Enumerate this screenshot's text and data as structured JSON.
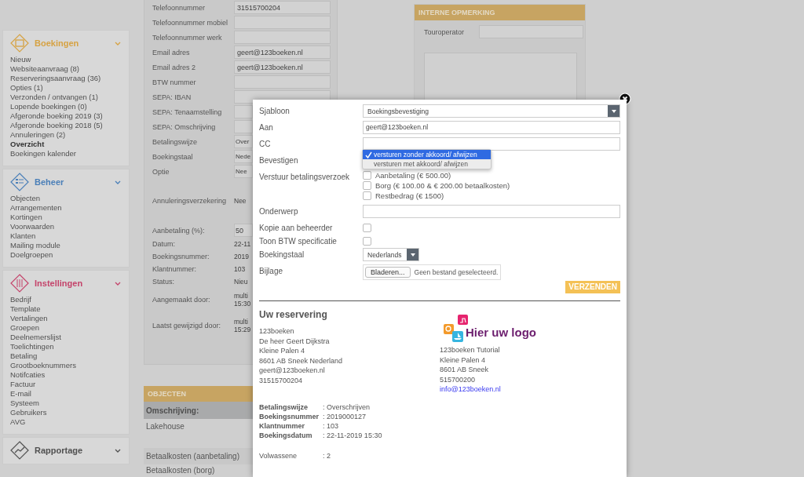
{
  "sidebar": {
    "sections": [
      {
        "title": "Boekingen",
        "color": "#d6a243",
        "items": [
          {
            "label": "Nieuw",
            "selected": false
          },
          {
            "label": "Websiteaanvraag (8)",
            "selected": false
          },
          {
            "label": "Reserveringsaanvraag (36)",
            "selected": false
          },
          {
            "label": "Opties (1)",
            "selected": false
          },
          {
            "label": "Verzonden / ontvangen (1)",
            "selected": false
          },
          {
            "label": "Lopende boekingen (0)",
            "selected": false
          },
          {
            "label": "Afgeronde boeking 2019 (3)",
            "selected": false
          },
          {
            "label": "Afgeronde boeking 2018 (5)",
            "selected": false
          },
          {
            "label": "Annuleringen (2)",
            "selected": false
          },
          {
            "label": "Overzicht",
            "selected": true
          },
          {
            "label": "Boekingen kalender",
            "selected": false
          }
        ]
      },
      {
        "title": "Beheer",
        "color": "#4a7fb8",
        "items": [
          {
            "label": "Objecten",
            "selected": false
          },
          {
            "label": "Arrangementen",
            "selected": false
          },
          {
            "label": "Kortingen",
            "selected": false
          },
          {
            "label": "Voorwaarden",
            "selected": false
          },
          {
            "label": "Klanten",
            "selected": false
          },
          {
            "label": "Mailing module",
            "selected": false
          },
          {
            "label": "Doelgroepen",
            "selected": false
          }
        ]
      },
      {
        "title": "Instellingen",
        "color": "#c4436a",
        "items": [
          {
            "label": "Bedrijf",
            "selected": false
          },
          {
            "label": "Template",
            "selected": false
          },
          {
            "label": "Vertalingen",
            "selected": false
          },
          {
            "label": "Groepen",
            "selected": false
          },
          {
            "label": "Deelnemerslijst",
            "selected": false
          },
          {
            "label": "Toelichtingen",
            "selected": false
          },
          {
            "label": "Betaling",
            "selected": false
          },
          {
            "label": "Grootboeknummers",
            "selected": false
          },
          {
            "label": "Notifcaties",
            "selected": false
          },
          {
            "label": "Factuur",
            "selected": false
          },
          {
            "label": "E-mail",
            "selected": false
          },
          {
            "label": "Systeem",
            "selected": false
          },
          {
            "label": "Gebruikers",
            "selected": false
          },
          {
            "label": "AVG",
            "selected": false
          }
        ]
      },
      {
        "title": "Rapportage",
        "color": "#505050"
      }
    ]
  },
  "customer_form": {
    "sections": [
      [
        {
          "kind": "input",
          "label": "Telefoonnummer",
          "value": "31515700204"
        },
        {
          "kind": "input",
          "label": "Telefoonnummer mobiel"
        },
        {
          "kind": "input",
          "label": "Telefoonnummer werk"
        },
        {
          "kind": "input",
          "label": "Email adres",
          "value": "geert@123boeken.nl"
        },
        {
          "kind": "input",
          "label": "Email adres 2",
          "value": "geert@123boeken.nl"
        },
        {
          "kind": "input",
          "label": "BTW nummer"
        },
        {
          "kind": "input",
          "label": "SEPA: IBAN"
        },
        {
          "kind": "input",
          "label": "SEPA: Tenaamstelling"
        },
        {
          "kind": "input",
          "label": "SEPA: Omschrijving"
        },
        {
          "kind": "input",
          "label": "Betalingswijze",
          "value": "Over"
        },
        {
          "kind": "input",
          "label": "Boekingstaal",
          "value": "Nede"
        },
        {
          "kind": "input",
          "label": "Optie",
          "value": "Nee"
        }
      ],
      [
        {
          "kind": "text",
          "label": "Annuleringsverzekering",
          "value": "Nee"
        }
      ],
      [
        {
          "kind": "input",
          "label": "Aanbetaling (%):",
          "value": "50"
        },
        {
          "kind": "text",
          "label": "Datum:",
          "value": "22-11"
        },
        {
          "kind": "text",
          "label": "Boekingsnummer:",
          "value": "2019"
        },
        {
          "kind": "text",
          "label": "Klantnummer:",
          "value": "103"
        },
        {
          "kind": "text",
          "label": "Status:",
          "value": "Nieu"
        },
        {
          "kind": "lines",
          "label": "Aangemaakt door:",
          "lines": [
            "multi",
            "15:30"
          ]
        },
        {
          "kind": "lines",
          "label": "Laatst gewijzigd door:",
          "lines": [
            "multi",
            "15:29"
          ]
        }
      ]
    ]
  },
  "objects": {
    "title": "OBJECTEN",
    "header": "Omschrijving:",
    "rows": [
      "Lakehouse",
      "Betaalkosten (aanbetaling)",
      "Betaalkosten (borg)"
    ]
  },
  "notes": {
    "title": "INTERNE OPMERKING",
    "field_label": "Touroperator"
  },
  "modal": {
    "rows": [
      {
        "kind": "select",
        "label": "Sjabloon",
        "value": "Boekingsbevestiging"
      },
      {
        "kind": "input",
        "label": "Aan",
        "value": "geert@123boeken.nl"
      },
      {
        "kind": "input",
        "label": "CC"
      },
      {
        "kind": "dropdown",
        "label": "Bevestigen",
        "options": [
          {
            "label": "versturen zonder akkoord/ afwijzen",
            "selected": true
          },
          {
            "label": "versturen met akkoord/ afwijzen",
            "selected": false
          }
        ]
      },
      {
        "kind": "checks",
        "label": "Verstuur betalingsverzoek",
        "options": [
          {
            "label": "Aanbetaling (€ 500.00)",
            "checked": false
          },
          {
            "label": "Borg (€ 100.00 & € 200.00 betaalkosten)",
            "checked": false
          },
          {
            "label": "Restbedrag (€ 1500)",
            "checked": false
          }
        ]
      },
      {
        "kind": "input",
        "label": "Onderwerp"
      },
      {
        "kind": "checkbox",
        "label": "Kopie aan beheerder",
        "checked": false
      },
      {
        "kind": "checkbox",
        "label": "Toon BTW specificatie",
        "checked": false
      },
      {
        "kind": "select_small",
        "label": "Boekingstaal",
        "value": "Nederlands"
      },
      {
        "kind": "file",
        "label": "Bijlage",
        "button": "Bladeren...",
        "value": "Geen bestand geselecteerd."
      }
    ],
    "submit": "VERZENDEN",
    "preview": {
      "title": "Uw reservering",
      "customer": [
        "123boeken",
        "De heer Geert Dijkstra",
        "Kleine Palen 4",
        "8601 AB Sneek Nederland",
        "geert@123boeken.nl",
        "31515700204"
      ],
      "logo_text": "Hier uw logo",
      "company": [
        "123boeken Tutorial",
        "Kleine Palen 4",
        "8601 AB Sneek",
        "515700200"
      ],
      "email": "info@123boeken.nl",
      "details": [
        {
          "label": "Betalingswijze",
          "value": ": Overschrijven"
        },
        {
          "label": "Boekingsnummer",
          "value": ": 2019000127"
        },
        {
          "label": "Klantnummer",
          "value": ": 103"
        },
        {
          "label": "Boekingsdatum",
          "value": ": 22-11-2019 15:30"
        }
      ],
      "extra": [
        {
          "label": "Volwassene",
          "value": ": 2"
        }
      ]
    }
  }
}
